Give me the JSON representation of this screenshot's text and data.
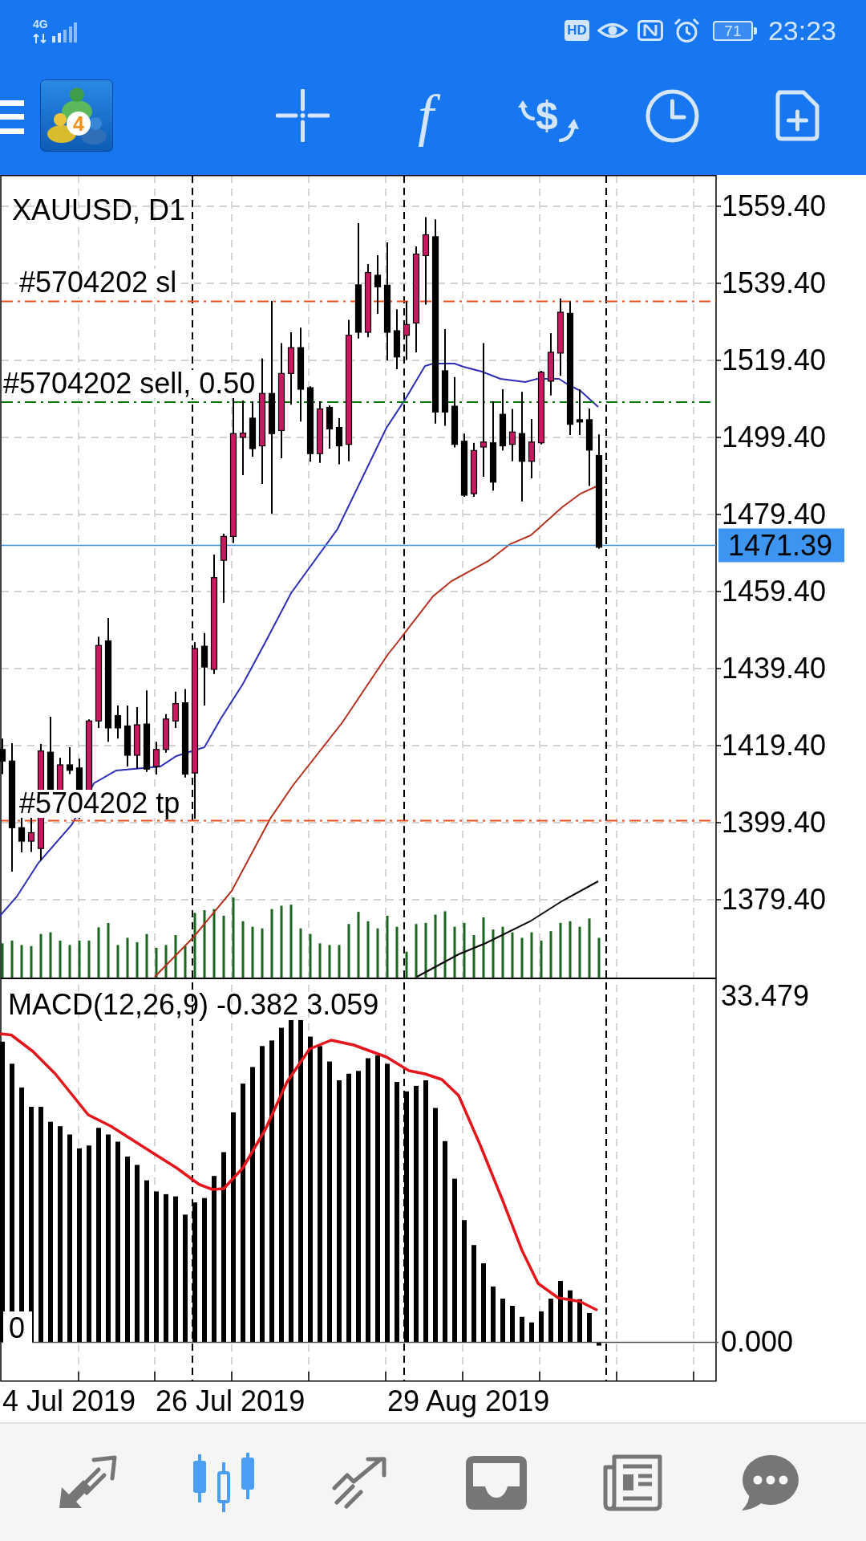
{
  "status_bar": {
    "network": "4G",
    "hd_badge": "HD",
    "battery": "71",
    "time": "23:23"
  },
  "toolbar": {
    "logo_badge": "4",
    "indicator_glyph": "f",
    "trade_glyph": "$"
  },
  "chart": {
    "title": "XAUUSD, D1",
    "price_scale": [
      "1559.40",
      "1539.40",
      "1519.40",
      "1499.40",
      "1479.40",
      "1459.40",
      "1439.40",
      "1419.40",
      "1399.40",
      "1379.40"
    ],
    "current_price": "1471.39",
    "order_lines": [
      {
        "kind": "stop_loss",
        "label": "#5704202 sl"
      },
      {
        "kind": "entry",
        "label": "#5704202 sell, 0.50"
      },
      {
        "kind": "take_profit",
        "label": "#5704202 tp"
      }
    ]
  },
  "indicator": {
    "title": "MACD(12,26,9) -0.382 3.059",
    "scale": [
      "33.479",
      "0.000"
    ],
    "zero_marker": "0"
  },
  "time_axis": [
    "4 Jul 2019",
    "26 Jul 2019",
    "29 Aug 2019"
  ],
  "bottom_nav": [
    {
      "selected": false
    },
    {
      "selected": true
    },
    {
      "selected": false
    },
    {
      "selected": false
    },
    {
      "selected": false
    },
    {
      "selected": false
    }
  ]
}
